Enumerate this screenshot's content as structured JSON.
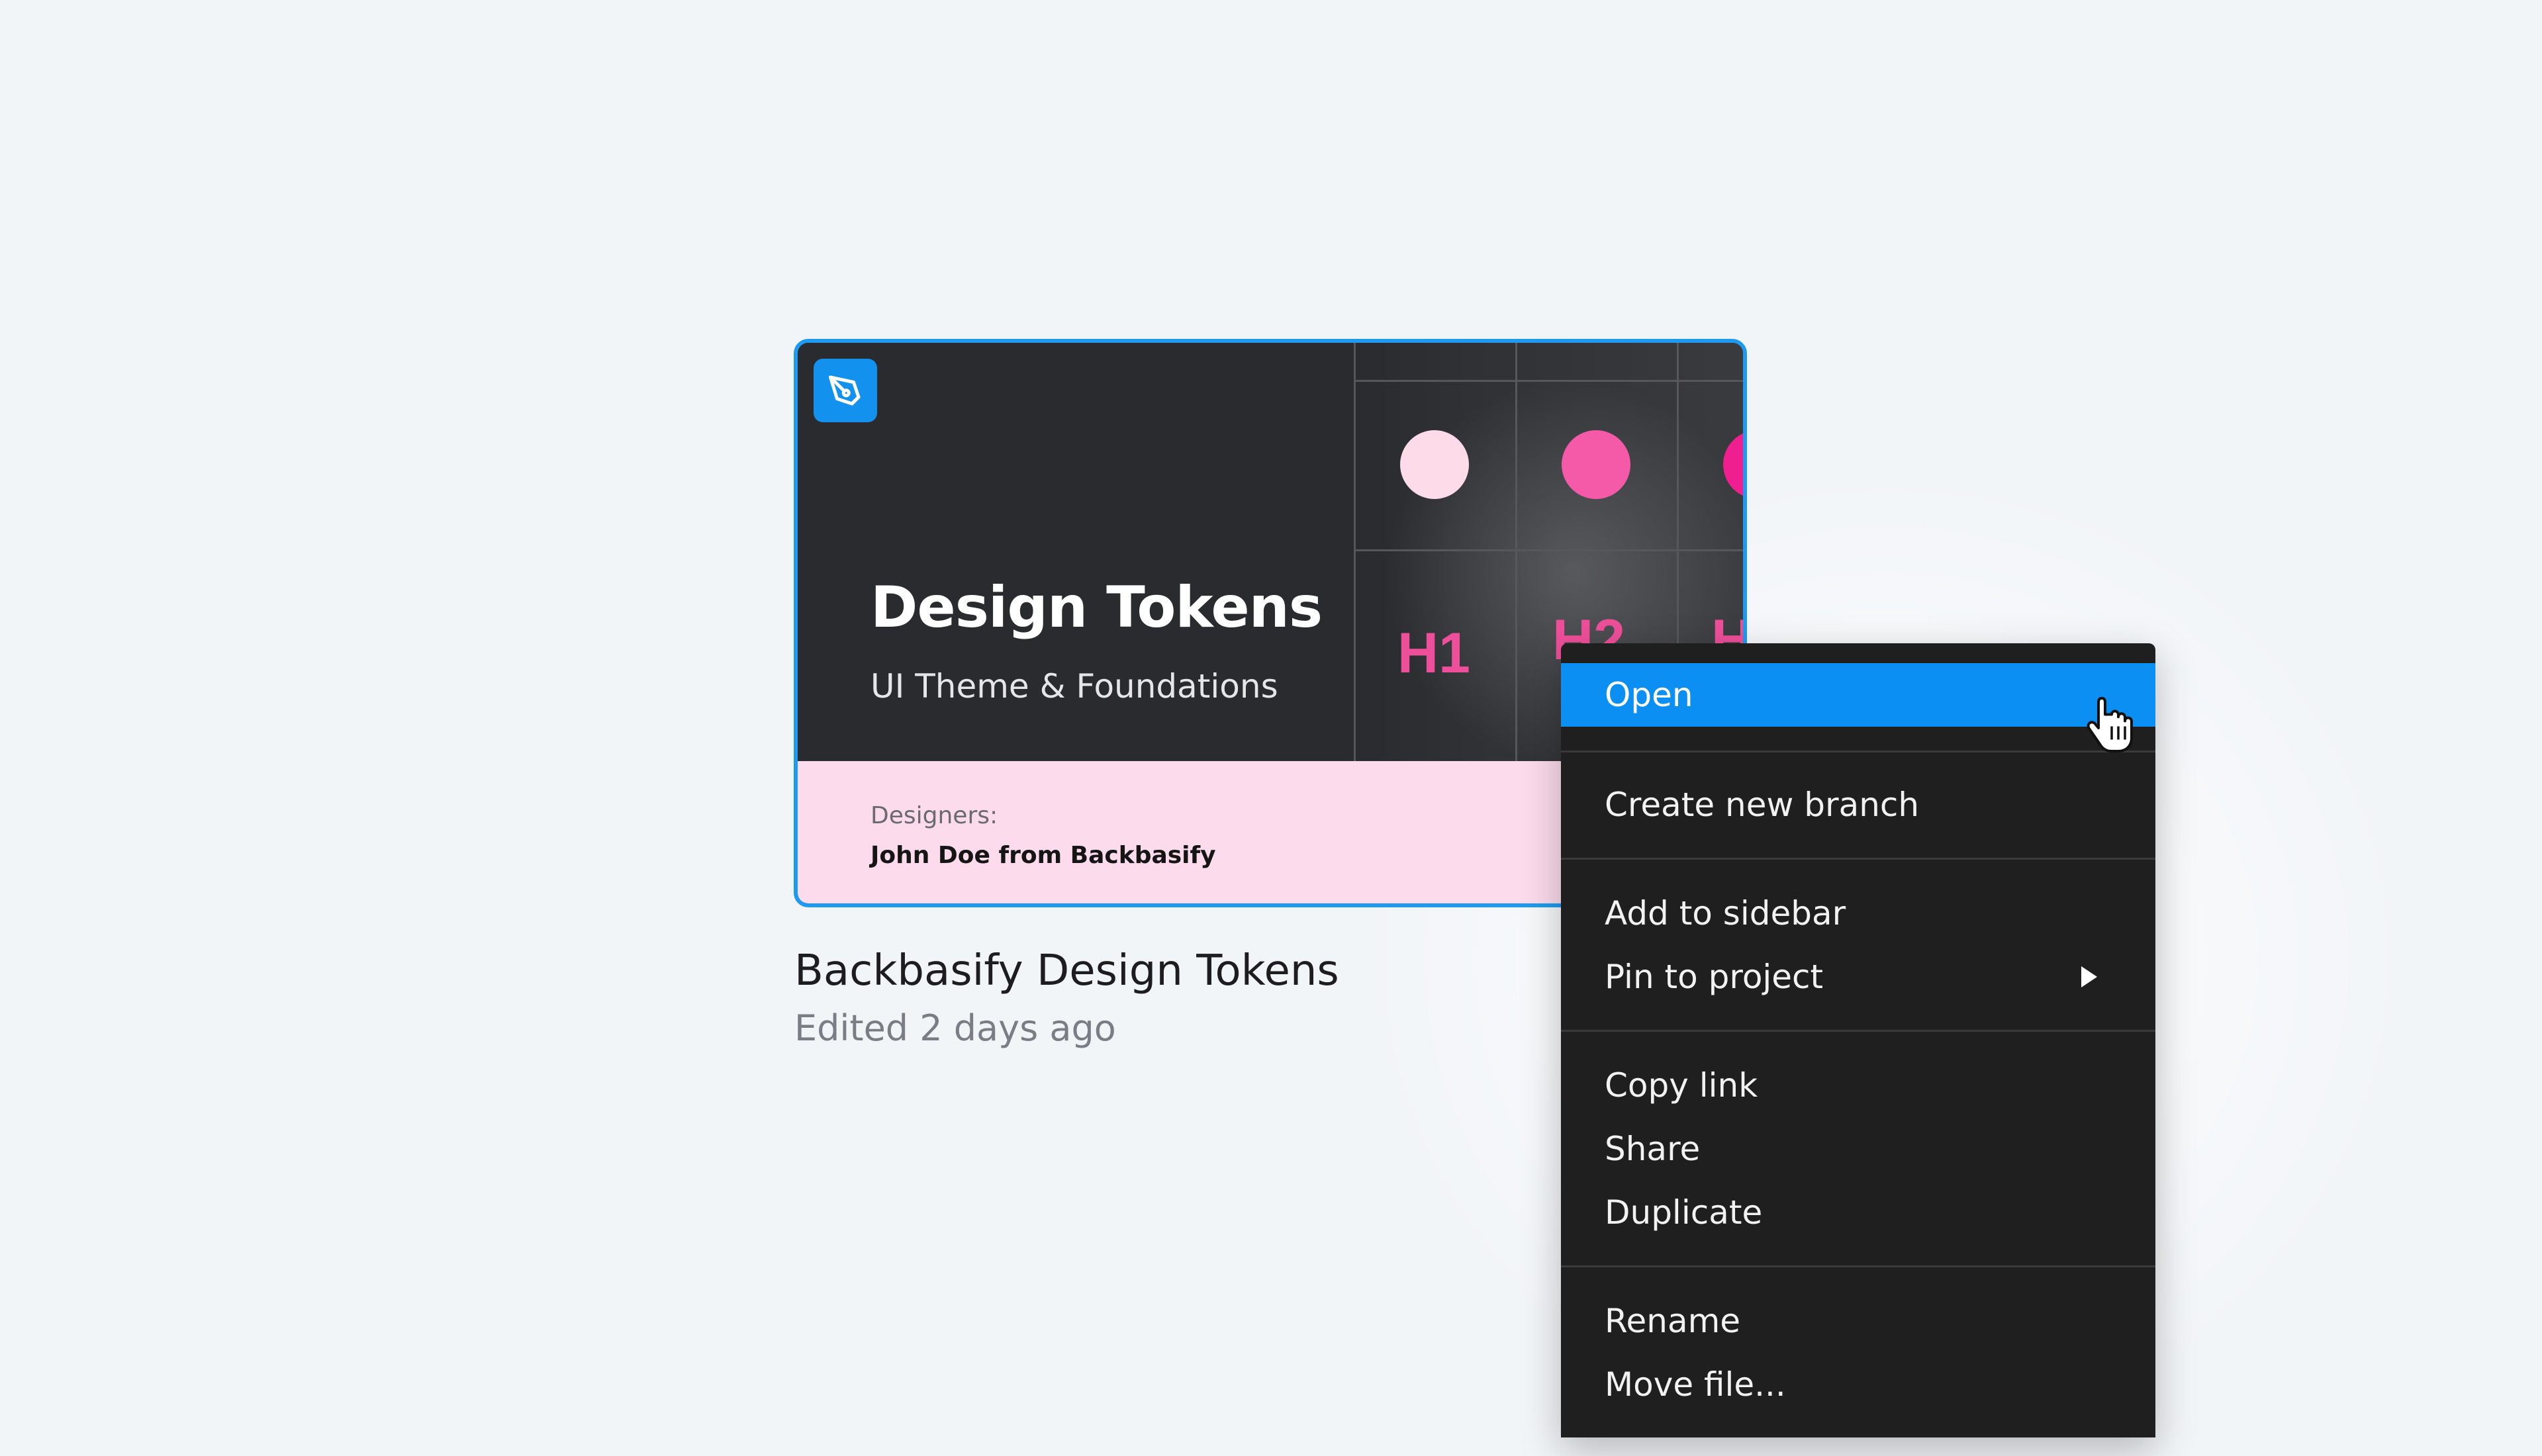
{
  "card": {
    "title": "Design Tokens",
    "subtitle": "UI Theme & Foundations",
    "designers_label": "Designers:",
    "designers_name": "John Doe from Backbasify",
    "app_icon": "pen-tool-icon",
    "preview_labels": [
      "H1",
      "H2",
      "H"
    ],
    "preview_colors": [
      "#fddbe9",
      "#f45aa8",
      "#ef1f8f"
    ]
  },
  "file": {
    "name": "Backbasify Design Tokens",
    "edited": "Edited 2 days ago"
  },
  "menu": {
    "items": [
      {
        "label": "Open",
        "active": true
      },
      {
        "label": "Create new branch"
      },
      {
        "label": "Add to sidebar"
      },
      {
        "label": "Pin to project",
        "submenu": true
      },
      {
        "label": "Copy link"
      },
      {
        "label": "Share"
      },
      {
        "label": "Duplicate"
      },
      {
        "label": "Rename"
      },
      {
        "label": "Move file..."
      }
    ],
    "accent_color": "#0c8ff2"
  },
  "cursor": "hand-pointer-icon"
}
